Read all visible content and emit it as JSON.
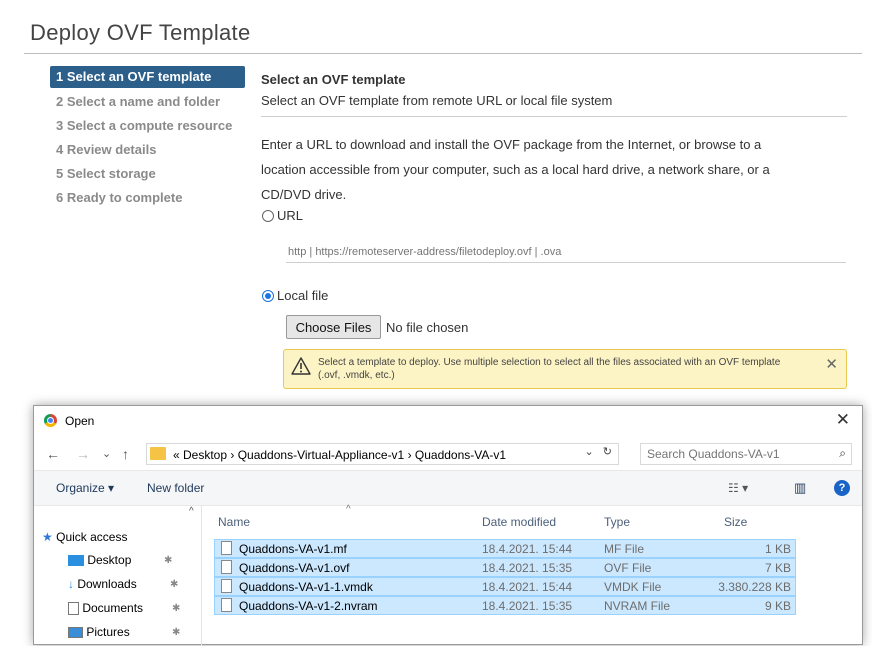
{
  "wizard": {
    "title": "Deploy OVF Template",
    "steps": [
      {
        "label": "1 Select an OVF template",
        "active": true
      },
      {
        "label": "2 Select a name and folder"
      },
      {
        "label": "3 Select a compute resource"
      },
      {
        "label": "4 Review details"
      },
      {
        "label": "5 Select storage"
      },
      {
        "label": "6 Ready to complete"
      }
    ],
    "section_title": "Select an OVF template",
    "section_subtitle": "Select an OVF template from remote URL or local file system",
    "description_lines": [
      "Enter a URL to download and install the OVF package from the Internet, or browse to a",
      "location accessible from your computer, such as a local hard drive, a network share, or a",
      "CD/DVD drive."
    ],
    "url_option_label": "URL",
    "url_placeholder": "http | https://remoteserver-address/filetodeploy.ovf | .ova",
    "local_option_label": "Local file",
    "choose_button_label": "Choose Files",
    "no_file_text": "No file chosen",
    "warning_text": "Select a template to deploy. Use multiple selection to select all the files associated with an OVF template (.ovf, .vmdk, etc.)"
  },
  "dialog": {
    "title": "Open",
    "close_glyph": "✕",
    "back_glyph": "←",
    "forward_glyph": "→",
    "recent_glyph": "⌄",
    "up_glyph": "↑",
    "breadcrumb": "« Desktop  ›  Quaddons-Virtual-Appliance-v1  ›  Quaddons-VA-v1",
    "address_dropdown_glyph": "⌄",
    "refresh_glyph": "↻",
    "search_placeholder": "Search Quaddons-VA-v1",
    "search_icon_glyph": "⌕",
    "organize_label": "Organize ▾",
    "new_folder_label": "New folder",
    "view_glyph": "☷ ▾",
    "pane_glyph": "▥",
    "help_glyph": "?",
    "sort_glyph": "^",
    "sidebar": [
      {
        "label": "Quick access",
        "icon": "star-icon"
      },
      {
        "label": "Desktop",
        "icon": "desktop-icon"
      },
      {
        "label": "Downloads",
        "icon": "download-icon"
      },
      {
        "label": "Documents",
        "icon": "documents-icon"
      },
      {
        "label": "Pictures",
        "icon": "pictures-icon"
      }
    ],
    "pin_glyph": "📌",
    "columns": [
      "Name",
      "Date modified",
      "Type",
      "Size"
    ],
    "files": [
      {
        "name": "Quaddons-VA-v1.mf",
        "date": "18.4.2021. 15:44",
        "type": "MF File",
        "size": "1 KB"
      },
      {
        "name": "Quaddons-VA-v1.ovf",
        "date": "18.4.2021. 15:35",
        "type": "OVF File",
        "size": "7 KB"
      },
      {
        "name": "Quaddons-VA-v1-1.vmdk",
        "date": "18.4.2021. 15:44",
        "type": "VMDK File",
        "size": "3.380.228 KB"
      },
      {
        "name": "Quaddons-VA-v1-2.nvram",
        "date": "18.4.2021. 15:35",
        "type": "NVRAM File",
        "size": "9 KB"
      }
    ]
  }
}
